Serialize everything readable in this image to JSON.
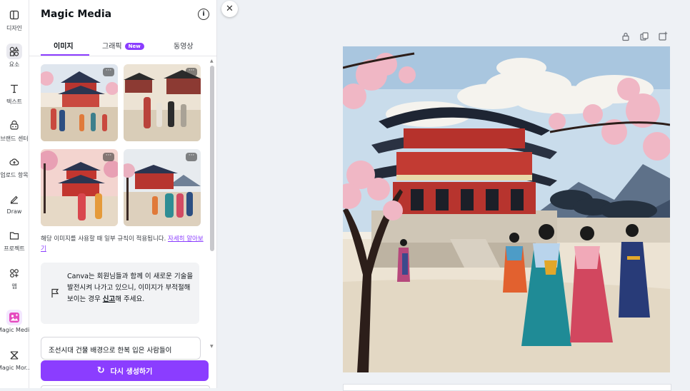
{
  "sidebar": {
    "items": [
      {
        "label": "디자인",
        "icon": "layout-icon"
      },
      {
        "label": "요소",
        "icon": "shapes-icon"
      },
      {
        "label": "텍스트",
        "icon": "text-icon"
      },
      {
        "label": "브랜드 센터",
        "icon": "brand-icon"
      },
      {
        "label": "업로드 항목",
        "icon": "upload-cloud-icon"
      },
      {
        "label": "Draw",
        "icon": "pen-icon"
      },
      {
        "label": "프로젝트",
        "icon": "folder-icon"
      },
      {
        "label": "앱",
        "icon": "apps-icon"
      },
      {
        "label": "Magic Media",
        "icon": "magic-media-icon"
      },
      {
        "label": "Magic Mor...",
        "icon": "magic-morph-icon"
      }
    ]
  },
  "panel": {
    "title": "Magic Media",
    "tabs": [
      {
        "label": "이미지"
      },
      {
        "label": "그래픽",
        "badge": "New"
      },
      {
        "label": "동영상"
      }
    ],
    "notice": "해당 이미지를 사용할 때 일부 규칙이 적용됩니다.",
    "notice_link": "자세히 알아보기",
    "feedback": {
      "text_before": "Canva는 회원님들과 함께 이 새로운 기술을 발전시켜 나가고 있으니, 이미지가 부적절해 보이는 경우 ",
      "report_link": "신고",
      "text_after": "해 주세요."
    },
    "prompt_value": "조선시대 건물 배경으로 한복 입은 사람들이",
    "regenerate_label": "다시 생성하기"
  },
  "colors": {
    "accent": "#8b3dff",
    "panel_bg": "#ffffff",
    "canvas_bg": "#eef1f5"
  }
}
